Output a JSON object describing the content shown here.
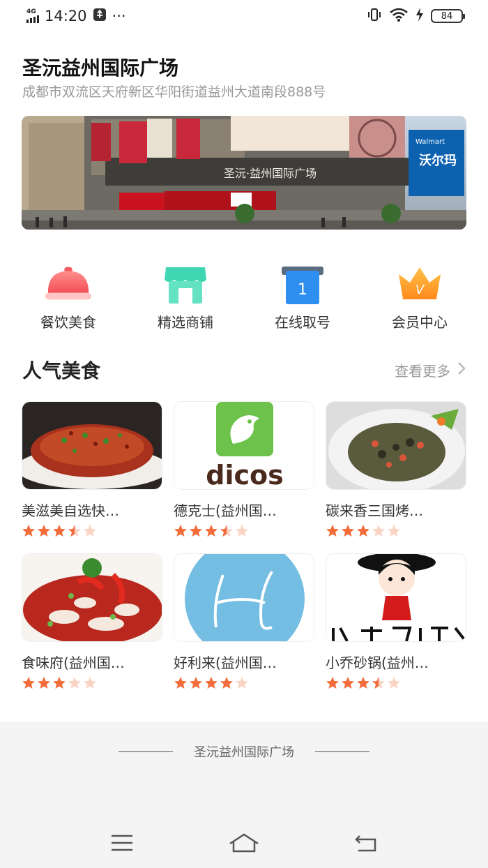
{
  "status_bar": {
    "network": "4G",
    "time": "14:20",
    "more": "···",
    "battery": "84"
  },
  "header": {
    "title": "圣沅益州国际广场",
    "address": "成都市双流区天府新区华阳街道益州大道南段888号"
  },
  "banner": {
    "sign_text": "圣沅·益州国际广场",
    "walmart_text": "沃尔玛",
    "walmart_en": "Walmart"
  },
  "quick_nav": [
    {
      "label": "餐饮美食",
      "icon": "food-cloche-icon"
    },
    {
      "label": "精选商铺",
      "icon": "store-icon"
    },
    {
      "label": "在线取号",
      "icon": "queue-number-icon"
    },
    {
      "label": "会员中心",
      "icon": "vip-crown-icon"
    }
  ],
  "popular_food": {
    "title": "人气美食",
    "more_label": "查看更多",
    "items": [
      {
        "name": "美滋美自选快…",
        "rating": 3.5
      },
      {
        "name": "德克士(益州国…",
        "rating": 3.5,
        "logo_text": "dicos"
      },
      {
        "name": "碳来香三国烤…",
        "rating": 3
      },
      {
        "name": "食味府(益州国…",
        "rating": 3
      },
      {
        "name": "好利来(益州国…",
        "rating": 4
      },
      {
        "name": "小乔砂锅(益州…",
        "rating": 3.5
      }
    ]
  },
  "footer": {
    "text": "圣沅益州国际广场"
  },
  "colors": {
    "star": "#f26b3a",
    "star_empty": "#fbd3c4",
    "accent_gray": "#999999"
  }
}
